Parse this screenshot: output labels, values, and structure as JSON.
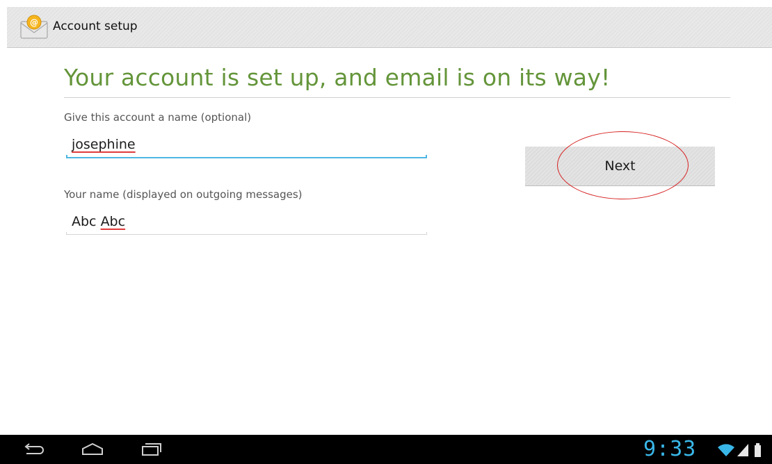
{
  "action_bar": {
    "title": "Account setup",
    "app_icon": "email-envelope-icon"
  },
  "main": {
    "headline": "Your account is set up, and email is on its way!",
    "account_name_field": {
      "label": "Give this account a name (optional)",
      "value": "josephine",
      "focused": true
    },
    "your_name_field": {
      "label": "Your name (displayed on outgoing messages)",
      "value_first": "Abc",
      "value_second": "Abc",
      "focused": false
    },
    "next_button": {
      "label": "Next"
    }
  },
  "system_bar": {
    "time": "9:33",
    "icons": [
      "back-icon",
      "home-icon",
      "recent-apps-icon",
      "wifi-icon",
      "signal-icon",
      "battery-icon"
    ]
  },
  "colors": {
    "headline_green": "#64953a",
    "focus_blue": "#4db6e3",
    "clock_blue": "#39b7e8",
    "annotation_red": "#d62020",
    "spellcheck_red": "#e03a3a"
  }
}
